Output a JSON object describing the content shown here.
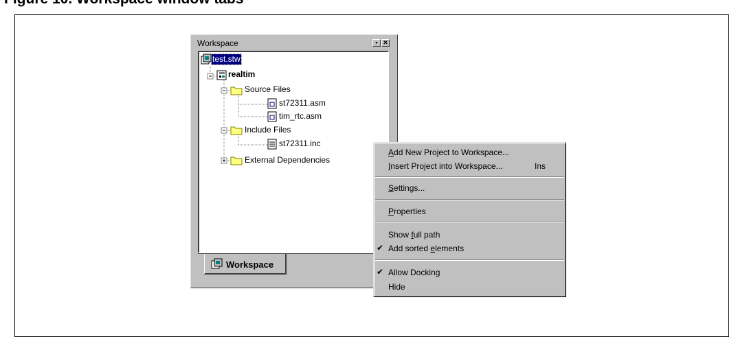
{
  "figure": {
    "title": "Figure 10.   Workspace window tabs"
  },
  "window": {
    "title": "Workspace",
    "tab_label": "Workspace"
  },
  "tree": [
    {
      "id": "n0",
      "label": "test.stw",
      "selected": true
    },
    {
      "id": "n1",
      "label": "realtim",
      "bold": true
    },
    {
      "id": "n2",
      "label": "Source Files"
    },
    {
      "id": "n3",
      "label": "st72311.asm"
    },
    {
      "id": "n4",
      "label": "tim_rtc.asm"
    },
    {
      "id": "n5",
      "label": "Include Files"
    },
    {
      "id": "n6",
      "label": "st72311.inc"
    },
    {
      "id": "n7",
      "label": "External Dependencies"
    }
  ],
  "menu": {
    "items": [
      {
        "label": "Add New Project to Workspace...",
        "mnemonic": "A",
        "rest": "dd New Project to Workspace...",
        "shortcut": ""
      },
      {
        "label": "Insert Project into Workspace...",
        "mnemonic": "I",
        "rest": "nsert Project into Workspace...",
        "shortcut": "Ins"
      },
      {
        "label": "Settings...",
        "mnemonic": "S",
        "rest": "ettings..."
      },
      {
        "label": "Properties",
        "mnemonic": "P",
        "rest": "roperties"
      },
      {
        "label": "Show full path",
        "pre": "Show ",
        "mnemonic": "f",
        "rest": "ull path"
      },
      {
        "label": "Add sorted elements",
        "pre": "Add sorted ",
        "mnemonic": "e",
        "rest": "lements",
        "checked": true
      },
      {
        "label": "Allow Docking",
        "checked": true
      },
      {
        "label": "Hide"
      }
    ],
    "check_glyph": "✔"
  },
  "icons": {
    "workspace": "workspace-icon",
    "project": "project-icon",
    "folder": "folder-icon",
    "asm_file": "asm-file-icon",
    "inc_file": "text-file-icon"
  }
}
